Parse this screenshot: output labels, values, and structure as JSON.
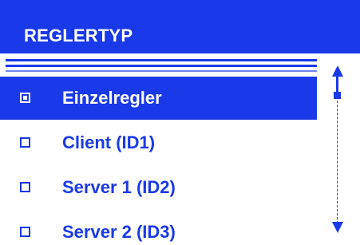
{
  "header": {
    "title": "REGLERTYP"
  },
  "list": {
    "items": [
      {
        "label": "Einzelregler",
        "selected": true
      },
      {
        "label": "Client (ID1)",
        "selected": false
      },
      {
        "label": "Server 1 (ID2)",
        "selected": false
      },
      {
        "label": "Server 2 (ID3)",
        "selected": false
      }
    ]
  },
  "scrollbar": {
    "position": 0.1,
    "up_icon": "triangle-up",
    "down_icon": "triangle-down"
  },
  "colors": {
    "accent": "#1a39e8",
    "background": "#ffffff",
    "selected_text": "#ffffff"
  }
}
